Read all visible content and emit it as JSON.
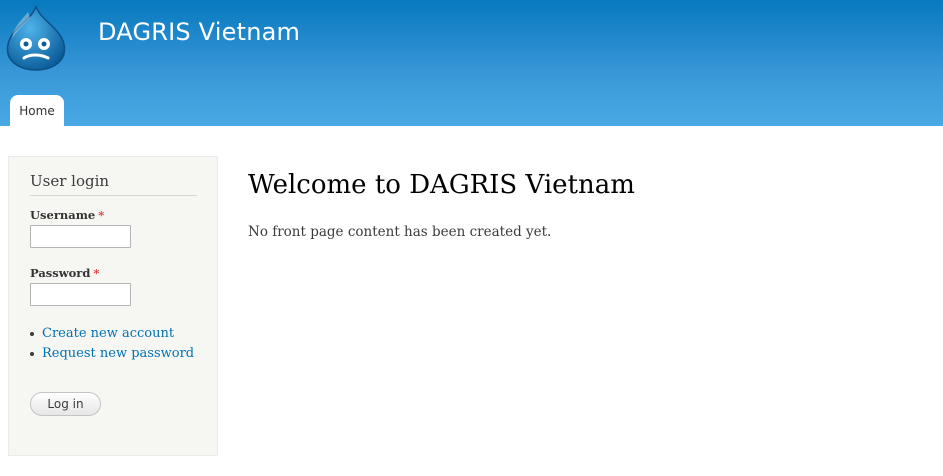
{
  "header": {
    "site_name": "DAGRIS Vietnam",
    "logo_icon": "drupal-drop-logo-icon",
    "colors": {
      "gradient_top": "#0779bf",
      "gradient_bottom": "#48a9e4"
    }
  },
  "nav": {
    "tabs": [
      {
        "label": "Home",
        "active": true
      }
    ]
  },
  "sidebar": {
    "login_block": {
      "title": "User login",
      "username_label": "Username",
      "password_label": "Password",
      "required_marker": "*",
      "username_value": "",
      "password_value": "",
      "links": [
        {
          "label": "Create new account"
        },
        {
          "label": "Request new password"
        }
      ],
      "submit_label": "Log in"
    }
  },
  "main": {
    "title": "Welcome to DAGRIS Vietnam",
    "message": "No front page content has been created yet."
  }
}
